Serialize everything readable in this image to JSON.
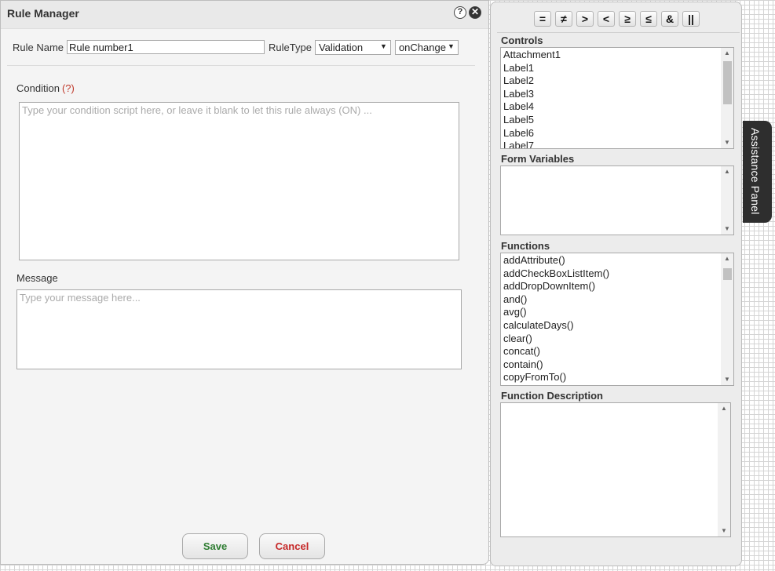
{
  "dialog": {
    "title": "Rule Manager",
    "help_icon": "?",
    "close_icon": "✕"
  },
  "form": {
    "rule_name_label": "Rule Name",
    "rule_name_value": "Rule number1",
    "rule_type_label": "RuleType",
    "rule_type_value": "Validation",
    "event_value": "onChange",
    "condition_label": "Condition",
    "condition_help": "(?)",
    "condition_placeholder": "Type your condition script here, or leave it blank to let this rule always (ON) ...",
    "message_label": "Message",
    "message_placeholder": "Type your message here..."
  },
  "buttons": {
    "save": "Save",
    "cancel": "Cancel"
  },
  "panel": {
    "operators": [
      "=",
      "≠",
      ">",
      "<",
      "≥",
      "≤",
      "&",
      "||"
    ],
    "controls_label": "Controls",
    "controls": [
      "Attachment1",
      "Label1",
      "Label2",
      "Label3",
      "Label4",
      "Label5",
      "Label6",
      "Label7"
    ],
    "form_variables_label": "Form Variables",
    "functions_label": "Functions",
    "functions": [
      "addAttribute()",
      "addCheckBoxListItem()",
      "addDropDownItem()",
      "and()",
      "avg()",
      "calculateDays()",
      "clear()",
      "concat()",
      "contain()",
      "copyFromTo()"
    ],
    "function_description_label": "Function Description"
  },
  "assistance_tab": {
    "label": "Assistance Panel"
  }
}
